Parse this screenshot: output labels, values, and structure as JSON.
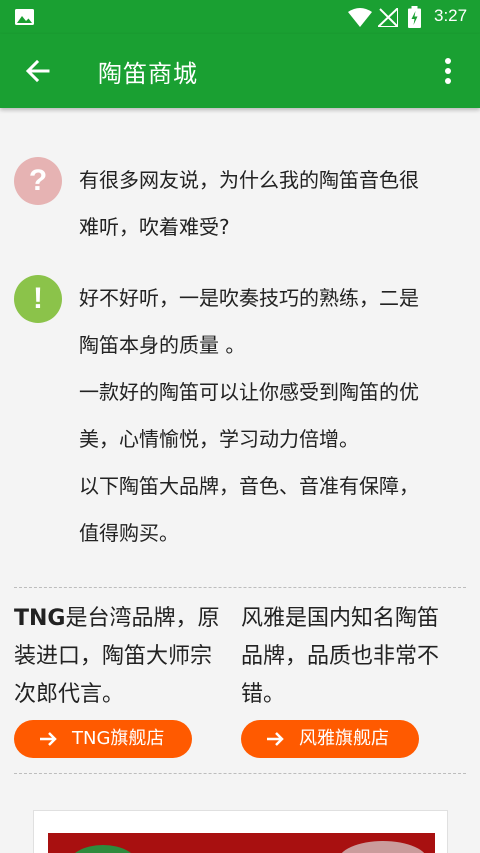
{
  "status_bar": {
    "time": "3:27",
    "icons": [
      "gallery-icon",
      "wifi-icon",
      "no-signal-icon",
      "battery-charging-icon"
    ]
  },
  "app_bar": {
    "title": "陶笛商城",
    "icons": [
      "back-arrow-icon",
      "more-vert-icon"
    ]
  },
  "question": {
    "icon_glyph": "?",
    "text_line1": "有很多网友说，为什么我的陶笛音色很",
    "text_line2": "难听，吹着难受?"
  },
  "answer": {
    "icon_glyph": "!",
    "lines": [
      "好不好听，一是吹奏技巧的熟练，二是",
      "陶笛本身的质量 。",
      "一款好的陶笛可以让你感受到陶笛的优",
      "美，心情愉悦，学习动力倍增。",
      "以下陶笛大品牌，音色、音准有保障，",
      "值得购买。"
    ]
  },
  "brands": [
    {
      "name": "TNG",
      "desc_lines": [
        "是台湾品牌，原",
        "装进口，陶笛大师宗",
        "次郎代言。"
      ],
      "button_label": "TNG旗舰店"
    },
    {
      "name": "",
      "desc_lines": [
        "风雅是国内知名陶笛",
        "品牌，品质也非常不",
        "错。"
      ],
      "button_label": "风雅旗舰店"
    }
  ],
  "colors": {
    "primary_green": "#1aa032",
    "button_orange": "#ff5a00",
    "question_pink": "#e6b3b3",
    "answer_green": "#8bc34a"
  }
}
